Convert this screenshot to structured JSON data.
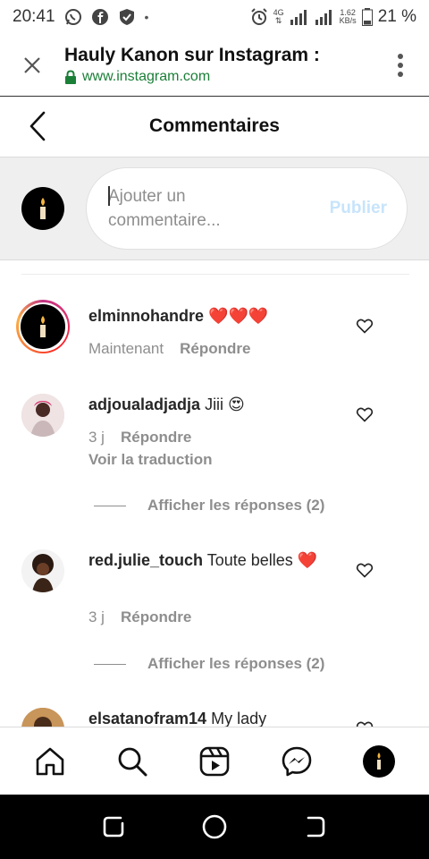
{
  "status": {
    "time": "20:41",
    "network": "4G",
    "speed_top": "1.62",
    "speed_bottom": "KB/s",
    "battery": "21 %"
  },
  "browser": {
    "title": "Hauly Kanon sur Instagram :",
    "url": "www.instagram.com"
  },
  "header": {
    "title": "Commentaires"
  },
  "composer": {
    "placeholder_line1": "Ajouter un",
    "placeholder_line2": "commentaire...",
    "publish_label": "Publier"
  },
  "comments": [
    {
      "username": "elminnohandre",
      "text": "❤️❤️❤️",
      "time": "Maintenant",
      "reply_label": "Répondre"
    },
    {
      "username": "adjoualadjadja",
      "text": "Jiii 😍",
      "time": "3 j",
      "reply_label": "Répondre",
      "translate_label": "Voir la traduction",
      "view_replies": "Afficher les réponses (2)"
    },
    {
      "username": "red.julie_touch",
      "text": "Toute belles ❤️",
      "time": "3 j",
      "reply_label": "Répondre",
      "view_replies": "Afficher les réponses (2)"
    },
    {
      "username": "elsatanofram14",
      "text": "My lady"
    }
  ],
  "colors": {
    "link_green": "#1a7f37",
    "publish_disabled": "#c7e4fb",
    "heart_red": "#ed4956",
    "muted": "#8e8e8e"
  }
}
